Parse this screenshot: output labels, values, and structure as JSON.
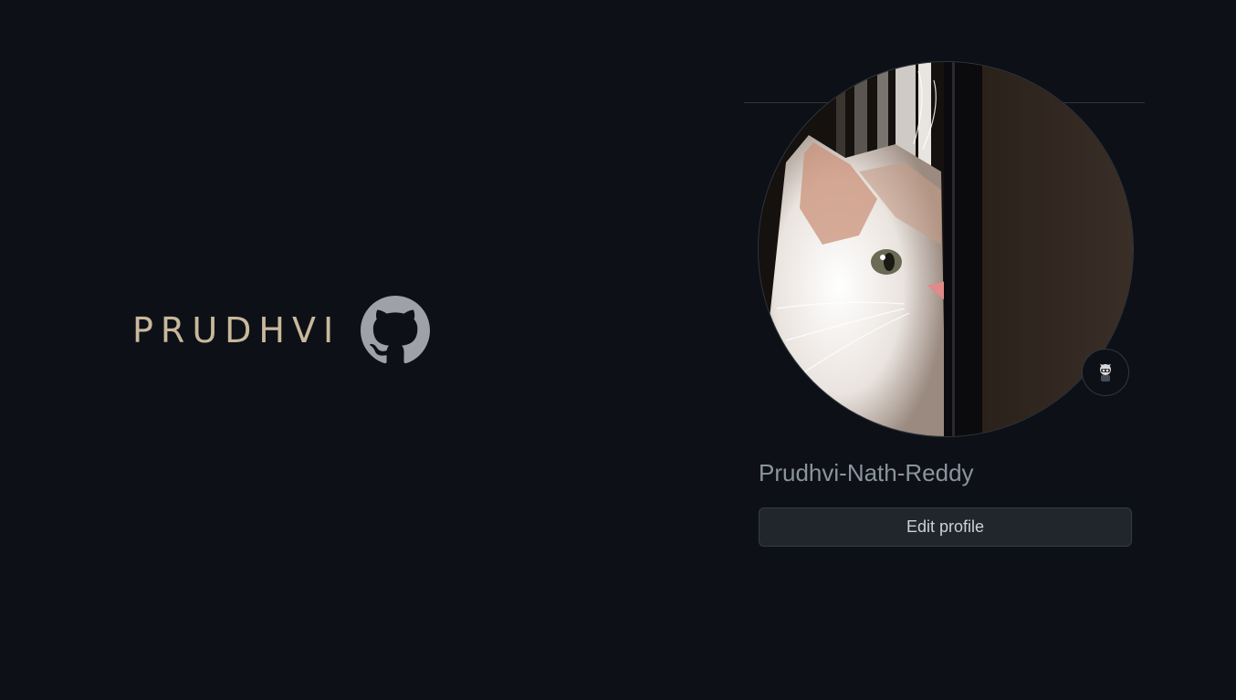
{
  "brand": {
    "name": "PRUDHVI",
    "logo_icon": "github-icon"
  },
  "profile": {
    "avatar_icon": "cat-avatar-image",
    "status_icon": "octocat-status-icon",
    "username": "Prudhvi-Nath-Reddy",
    "edit_button_label": "Edit profile"
  },
  "colors": {
    "background": "#0d1117",
    "brand_text": "#c9b89b",
    "logo": "#9ea1a6",
    "username": "#8b949e",
    "button_bg": "#21262d",
    "button_text": "#c9d1d9",
    "border": "#30363d"
  }
}
